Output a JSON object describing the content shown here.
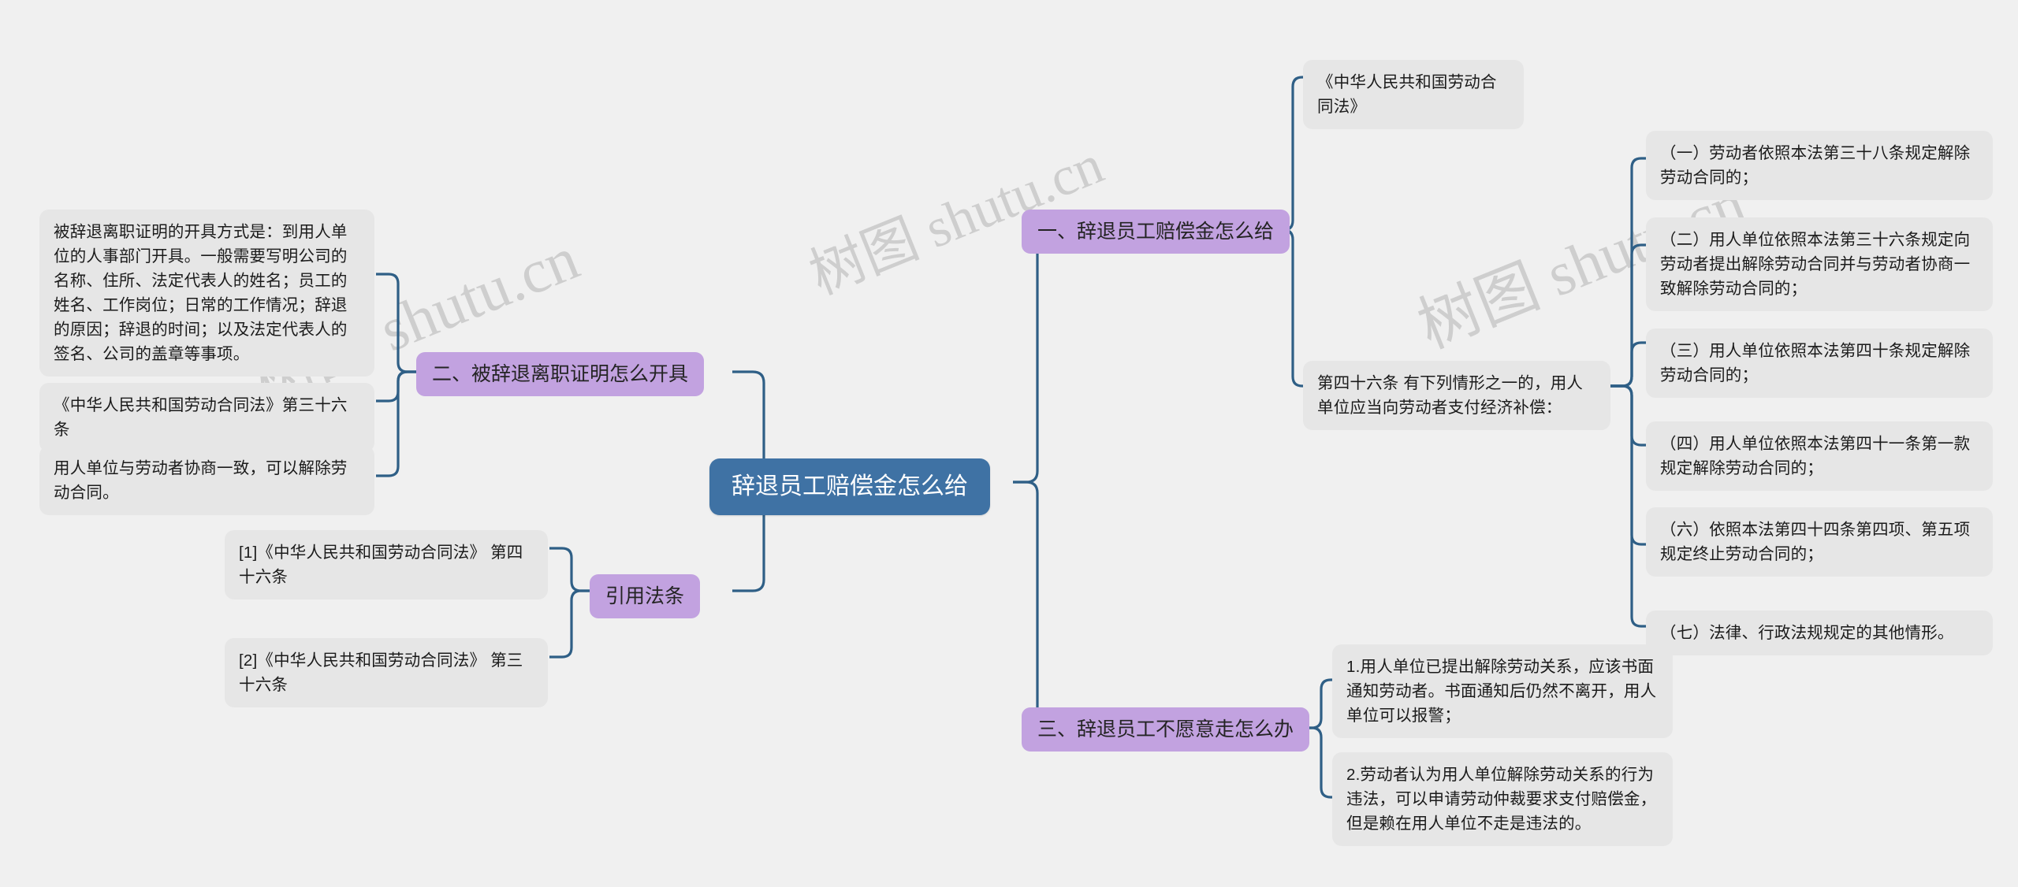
{
  "watermark": {
    "text": "树图 shutu.cn"
  },
  "colors": {
    "background": "#f0f0f0",
    "root_fill": "#3f72a4",
    "root_text": "#ffffff",
    "topic_fill": "#c2a2e0",
    "leaf_fill": "#e6e6e6",
    "connector": "#2f5f86"
  },
  "root": {
    "label": "辞退员工赔偿金怎么给"
  },
  "branches": {
    "b1": {
      "label": "一、辞退员工赔偿金怎么给",
      "children": [
        {
          "text": "《中华人民共和国劳动合同法》"
        },
        {
          "text": "第四十六条 有下列情形之一的，用人单位应当向劳动者支付经济补偿："
        }
      ],
      "grandchildren": [
        {
          "text": "（一）劳动者依照本法第三十八条规定解除劳动合同的；"
        },
        {
          "text": "（二）用人单位依照本法第三十六条规定向劳动者提出解除劳动合同并与劳动者协商一致解除劳动合同的；"
        },
        {
          "text": "（三）用人单位依照本法第四十条规定解除劳动合同的；"
        },
        {
          "text": "（四）用人单位依照本法第四十一条第一款规定解除劳动合同的；"
        },
        {
          "text": "（六）依照本法第四十四条第四项、第五项规定终止劳动合同的；"
        },
        {
          "text": "（七）法律、行政法规规定的其他情形。"
        }
      ]
    },
    "b2": {
      "label": "二、被辞退离职证明怎么开具",
      "children": [
        {
          "text": "被辞退离职证明的开具方式是：到用人单位的人事部门开具。一般需要写明公司的名称、住所、法定代表人的姓名；员工的姓名、工作岗位；日常的工作情况；辞退的原因；辞退的时间；以及法定代表人的签名、公司的盖章等事项。"
        },
        {
          "text": "《中华人民共和国劳动合同法》第三十六条"
        },
        {
          "text": "用人单位与劳动者协商一致，可以解除劳动合同。"
        }
      ]
    },
    "b3": {
      "label": "三、辞退员工不愿意走怎么办",
      "children": [
        {
          "text": "1.用人单位已提出解除劳动关系，应该书面通知劳动者。书面通知后仍然不离开，用人单位可以报警；"
        },
        {
          "text": "2.劳动者认为用人单位解除劳动关系的行为违法，可以申请劳动仲裁要求支付赔偿金，但是赖在用人单位不走是违法的。"
        }
      ]
    },
    "b4": {
      "label": "引用法条",
      "children": [
        {
          "text": "[1]《中华人民共和国劳动合同法》 第四十六条"
        },
        {
          "text": "[2]《中华人民共和国劳动合同法》 第三十六条"
        }
      ]
    }
  }
}
